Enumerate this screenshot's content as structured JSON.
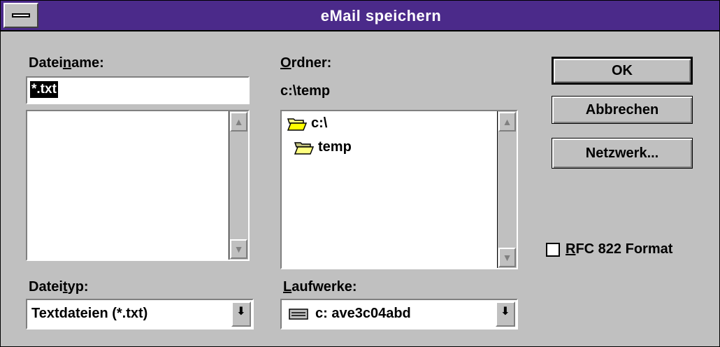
{
  "window": {
    "title": "eMail speichern"
  },
  "filename": {
    "label_pre": "Datei",
    "label_u": "n",
    "label_post": "ame:",
    "value": "*.txt"
  },
  "folder": {
    "label_u": "O",
    "label_post": "rdner:",
    "current_path": "c:\\temp",
    "tree": [
      "c:\\",
      "temp"
    ]
  },
  "filetype": {
    "label_pre": "Datei",
    "label_u": "t",
    "label_post": "yp:",
    "selected": "Textdateien (*.txt)"
  },
  "drives": {
    "label_u": "L",
    "label_post": "aufwerke:",
    "selected": "c: ave3c04abd"
  },
  "buttons": {
    "ok": "OK",
    "cancel": "Abbrechen",
    "network": "Netzwerk..."
  },
  "rfc": {
    "label_u": "R",
    "label_post": "FC 822 Format",
    "checked": false
  },
  "icons": {
    "system_menu": "system-menu-icon",
    "open_folder": "open-folder-icon",
    "drive": "hard-drive-icon"
  }
}
